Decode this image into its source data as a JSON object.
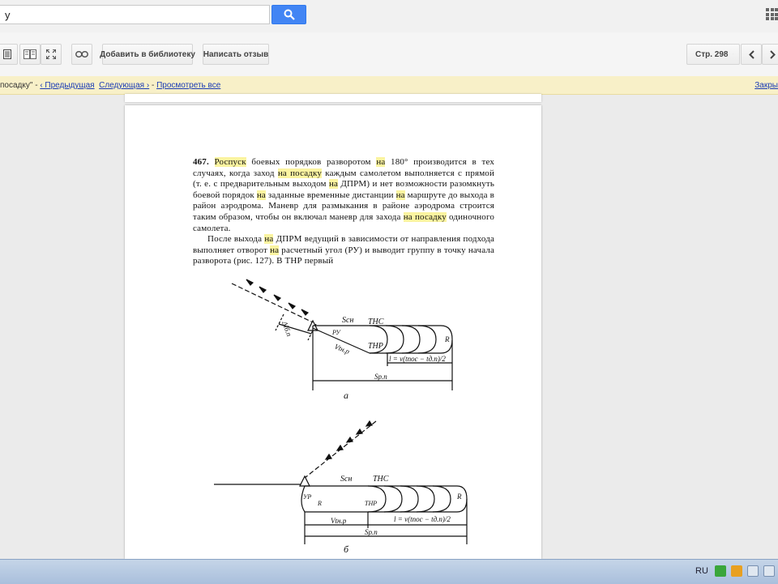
{
  "search": {
    "value": "у"
  },
  "toolbar": {
    "add_library": "Добавить в библиотеку",
    "write_review": "Написать отзыв",
    "page_label": "Стр. 298"
  },
  "infobar": {
    "query": "посадку\"",
    "sep": " - ",
    "prev": "‹ Предыдущая",
    "next": "Следующая ›",
    "view_all": "Просмотреть все",
    "close": "Закры"
  },
  "book": {
    "para1": [
      {
        "t": "467.",
        "b": true
      },
      {
        "t": " "
      },
      {
        "t": "Роспуск",
        "h": true
      },
      {
        "t": " боевых порядков разворотом "
      },
      {
        "t": "на",
        "h": true
      },
      {
        "t": " 180° производится в тех случаях, когда заход "
      },
      {
        "t": "на посадку",
        "h": true
      },
      {
        "t": " каждым самолетом выполняется с прямой (т. е. с предварительным выходом "
      },
      {
        "t": "на",
        "h": true
      },
      {
        "t": " ДПРМ) и нет возможности разомкнуть боевой порядок "
      },
      {
        "t": "на",
        "h": true
      },
      {
        "t": " заданные временные дистанции "
      },
      {
        "t": "на",
        "h": true
      },
      {
        "t": " маршруте до выхода в район аэродрома. Маневр для размыкания в районе аэродрома строится таким образом, чтобы он включал маневр для захода "
      },
      {
        "t": "на посадку",
        "h": true
      },
      {
        "t": " одиночного самолета."
      }
    ],
    "para2": [
      {
        "t": "После выхода "
      },
      {
        "t": "на",
        "h": true
      },
      {
        "t": " ДПРМ ведущий в зависимости от направления подхода выполняет отворот "
      },
      {
        "t": "на",
        "h": true
      },
      {
        "t": " расчетный угол (РУ) и выводит группу в точку начала разворота (рис. 127). В ТНР первый"
      }
    ]
  },
  "fig_a": {
    "scn": "Sсн",
    "thc": "ТНС",
    "thr": "ТНР",
    "ru": "РУ",
    "r": "R",
    "vt": "Vtн.р",
    "dl": "Δlб.п",
    "len": "l = v(tпос − tд.п)/2",
    "sp": "Sр.п",
    "caption": "а"
  },
  "fig_b": {
    "scn": "Sсн",
    "thc": "ТНС",
    "thr": "ТНР",
    "ur": "УР",
    "r1": "R",
    "r2": "R",
    "vt": "Vtн.р",
    "len": "l = v(tпос − tд.п)/2",
    "sp": "Sр.п",
    "caption": "б"
  },
  "taskbar": {
    "lang": "RU"
  }
}
